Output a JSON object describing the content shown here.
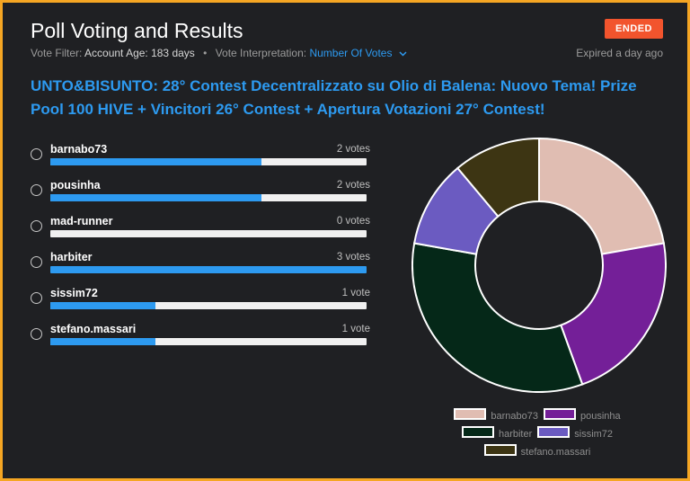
{
  "header": {
    "title": "Poll Voting and Results",
    "status": "ENDED",
    "expired": "Expired a day ago"
  },
  "meta": {
    "filter_label": "Vote Filter:",
    "filter_value": "Account Age: 183 days",
    "separator": "•",
    "interp_label": "Vote Interpretation:",
    "interp_value": "Number Of Votes",
    "interp_icon": "chevron-down-icon"
  },
  "question": "UNTO&BISUNTO: 28° Contest Decentralizzato su Olio di Balena: Nuovo Tema! Prize Pool 100 HIVE + Vincitori 26° Contest + Apertura Votazioni 27° Contest!",
  "options": [
    {
      "name": "barnabo73",
      "votes_text": "2 votes",
      "fraction": 0.6667,
      "color": "#e0bdb2"
    },
    {
      "name": "pousinha",
      "votes_text": "2 votes",
      "fraction": 0.6667,
      "color": "#741f98"
    },
    {
      "name": "mad-runner",
      "votes_text": "0 votes",
      "fraction": 0,
      "color": "#ffffff"
    },
    {
      "name": "harbiter",
      "votes_text": "3 votes",
      "fraction": 1.0,
      "color": "#052818"
    },
    {
      "name": "sissim72",
      "votes_text": "1 vote",
      "fraction": 0.3333,
      "color": "#6b5bc1"
    },
    {
      "name": "stefano.massari",
      "votes_text": "1 vote",
      "fraction": 0.3333,
      "color": "#3d3513"
    }
  ],
  "chart_data": {
    "type": "pie",
    "donut": true,
    "legend_placement": "bottom",
    "categories": [
      "barnabo73",
      "pousinha",
      "harbiter",
      "sissim72",
      "stefano.massari"
    ],
    "values": [
      2,
      2,
      3,
      1,
      1
    ],
    "colors": [
      "#e0bdb2",
      "#741f98",
      "#052818",
      "#6b5bc1",
      "#3d3513"
    ]
  },
  "colors": {
    "accent": "#2d9af0",
    "status": "#f2542d",
    "frame": "#f5a623",
    "background": "#1f2023"
  }
}
